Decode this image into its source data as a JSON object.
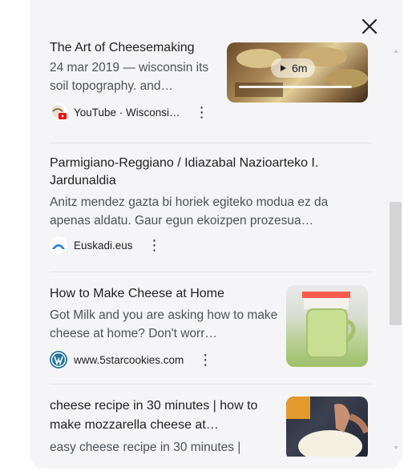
{
  "close_label": "Close",
  "results": [
    {
      "title": "The Art of Cheesemaking",
      "snippet": "24 mar 2019 — wisconsin its soil topography. and…",
      "source_label": "YouTube · Wisconsi…",
      "video_duration": "6m",
      "thumb_icon": "cheese-wheels-thumbnail"
    },
    {
      "title": "Parmigiano-Reggiano / Idiazabal Nazioarteko I. Jardunaldia",
      "snippet": "Anitz mendez gazta bi horiek egiteko modua ez da apenas aldatu. Gaur egun ekoizpen prozesua…",
      "source_label": "Euskadi.eus"
    },
    {
      "title": "How to Make Cheese at Home",
      "snippet": "Got Milk and you are asking how to make cheese at home? Don't worr…",
      "source_label": "www.5starcookies.com",
      "thumb_icon": "milk-jar-thumbnail"
    },
    {
      "title": "cheese recipe in 30 minutes | how to make mozzarella cheese at…",
      "snippet": "easy cheese recipe in 30 minutes |",
      "thumb_icon": "mozzarella-thumbnail"
    }
  ],
  "colors": {
    "panel_bg": "#f5f5f7",
    "title": "#1f1f1f",
    "snippet": "#4d5156",
    "youtube_red": "#ff0000",
    "euskadi_blue": "#1a73e8",
    "wordpress_blue": "#21759b"
  }
}
